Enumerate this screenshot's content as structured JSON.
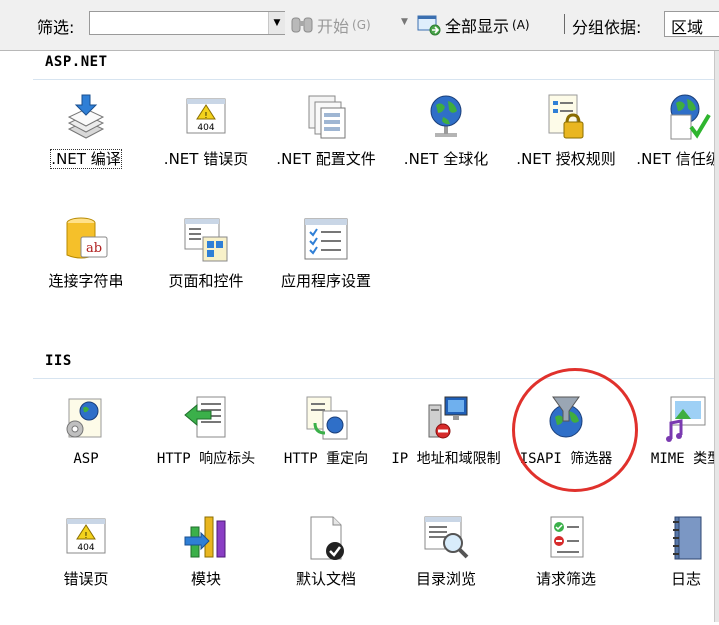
{
  "toolbar": {
    "filter_label": "筛选:",
    "filter_value": "",
    "start_label": "开始",
    "start_key": "(G)",
    "show_all_label": "全部显示",
    "show_all_key": "(A)",
    "group_label": "分组依据:",
    "group_value": "区域"
  },
  "sections": [
    {
      "title": "ASP.NET",
      "items": [
        {
          "label": ".NET 编译",
          "icon": "net-compile-icon",
          "selected": true
        },
        {
          "label": ".NET 错误页",
          "icon": "net-error-pages-icon"
        },
        {
          "label": ".NET 配置文件",
          "icon": "net-profile-icon"
        },
        {
          "label": ".NET 全球化",
          "icon": "net-globalization-icon"
        },
        {
          "label": ".NET 授权规则",
          "icon": "net-authorization-rules-icon"
        },
        {
          "label": ".NET 信任级别",
          "icon": "net-trust-levels-icon"
        },
        {
          "label": "连接字符串",
          "icon": "connection-strings-icon"
        },
        {
          "label": "页面和控件",
          "icon": "pages-controls-icon"
        },
        {
          "label": "应用程序设置",
          "icon": "app-settings-icon"
        }
      ]
    },
    {
      "title": "IIS",
      "items": [
        {
          "label": "ASP",
          "icon": "asp-icon"
        },
        {
          "label": "HTTP 响应标头",
          "icon": "http-response-headers-icon"
        },
        {
          "label": "HTTP 重定向",
          "icon": "http-redirect-icon"
        },
        {
          "label": "IP 地址和域限制",
          "icon": "ip-domain-restrictions-icon"
        },
        {
          "label": "ISAPI 筛选器",
          "icon": "isapi-filters-icon",
          "highlighted": true
        },
        {
          "label": "MIME 类型",
          "icon": "mime-types-icon"
        },
        {
          "label": "错误页",
          "icon": "error-pages-icon"
        },
        {
          "label": "模块",
          "icon": "modules-icon"
        },
        {
          "label": "默认文档",
          "icon": "default-document-icon"
        },
        {
          "label": "目录浏览",
          "icon": "directory-browsing-icon"
        },
        {
          "label": "请求筛选",
          "icon": "request-filtering-icon"
        },
        {
          "label": "日志",
          "icon": "logging-icon"
        }
      ]
    }
  ],
  "colors": {
    "highlight_circle": "#e0312c",
    "toolbar_bg": "#f0f0f0",
    "section_rule": "#d7e4f0"
  }
}
